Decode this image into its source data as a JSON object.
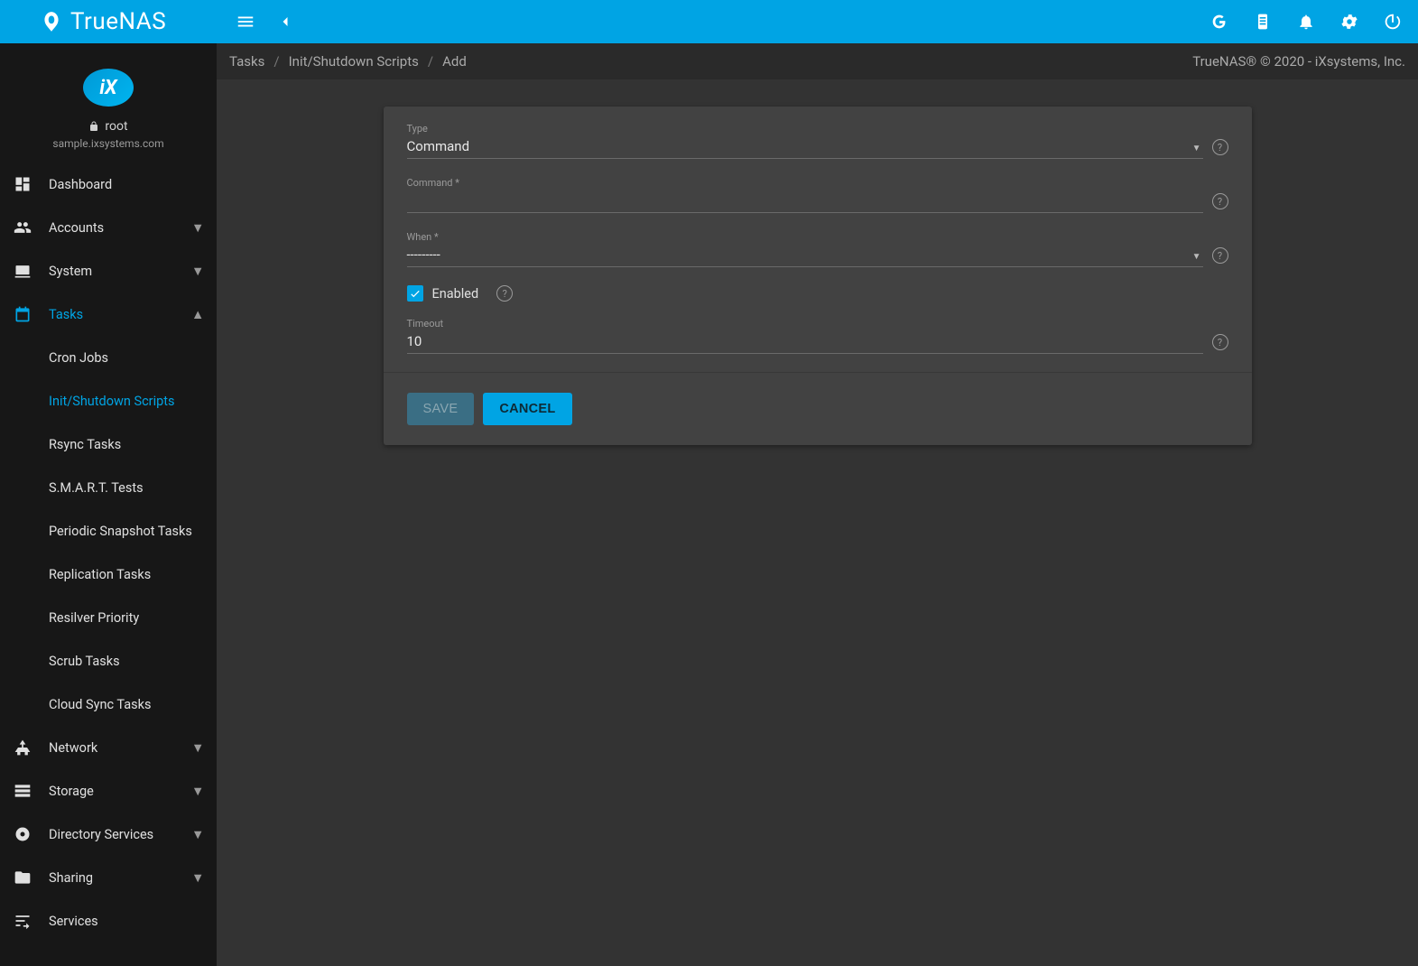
{
  "topbar": {
    "product": "TrueNAS",
    "icons": [
      "ha-status",
      "clipboard",
      "notifications",
      "settings",
      "power"
    ]
  },
  "user_block": {
    "username": "root",
    "hostname": "sample.ixsystems.com"
  },
  "sidebar": [
    {
      "label": "Dashboard",
      "icon": "dashboard-icon",
      "expandable": false,
      "active": false
    },
    {
      "label": "Accounts",
      "icon": "accounts-icon",
      "expandable": true,
      "active": false
    },
    {
      "label": "System",
      "icon": "system-icon",
      "expandable": true,
      "active": false
    },
    {
      "label": "Tasks",
      "icon": "tasks-icon",
      "expandable": true,
      "active": true,
      "expanded": true,
      "children": [
        {
          "label": "Cron Jobs",
          "active": false
        },
        {
          "label": "Init/Shutdown Scripts",
          "active": true
        },
        {
          "label": "Rsync Tasks",
          "active": false
        },
        {
          "label": "S.M.A.R.T. Tests",
          "active": false
        },
        {
          "label": "Periodic Snapshot Tasks",
          "active": false
        },
        {
          "label": "Replication Tasks",
          "active": false
        },
        {
          "label": "Resilver Priority",
          "active": false
        },
        {
          "label": "Scrub Tasks",
          "active": false
        },
        {
          "label": "Cloud Sync Tasks",
          "active": false
        }
      ]
    },
    {
      "label": "Network",
      "icon": "network-icon",
      "expandable": true,
      "active": false
    },
    {
      "label": "Storage",
      "icon": "storage-icon",
      "expandable": true,
      "active": false
    },
    {
      "label": "Directory Services",
      "icon": "directory-icon",
      "expandable": true,
      "active": false
    },
    {
      "label": "Sharing",
      "icon": "sharing-icon",
      "expandable": true,
      "active": false
    },
    {
      "label": "Services",
      "icon": "services-icon",
      "expandable": false,
      "active": false
    }
  ],
  "breadcrumb": {
    "sep": "/",
    "items": [
      "Tasks",
      "Init/Shutdown Scripts",
      "Add"
    ]
  },
  "copyright": "TrueNAS® © 2020 - iXsystems, Inc.",
  "form": {
    "type_label": "Type",
    "type_value": "Command",
    "command_label": "Command *",
    "command_value": "",
    "when_label": "When *",
    "when_value": "---------",
    "enabled_label": "Enabled",
    "enabled_checked": true,
    "timeout_label": "Timeout",
    "timeout_value": "10",
    "save_label": "SAVE",
    "cancel_label": "CANCEL"
  }
}
